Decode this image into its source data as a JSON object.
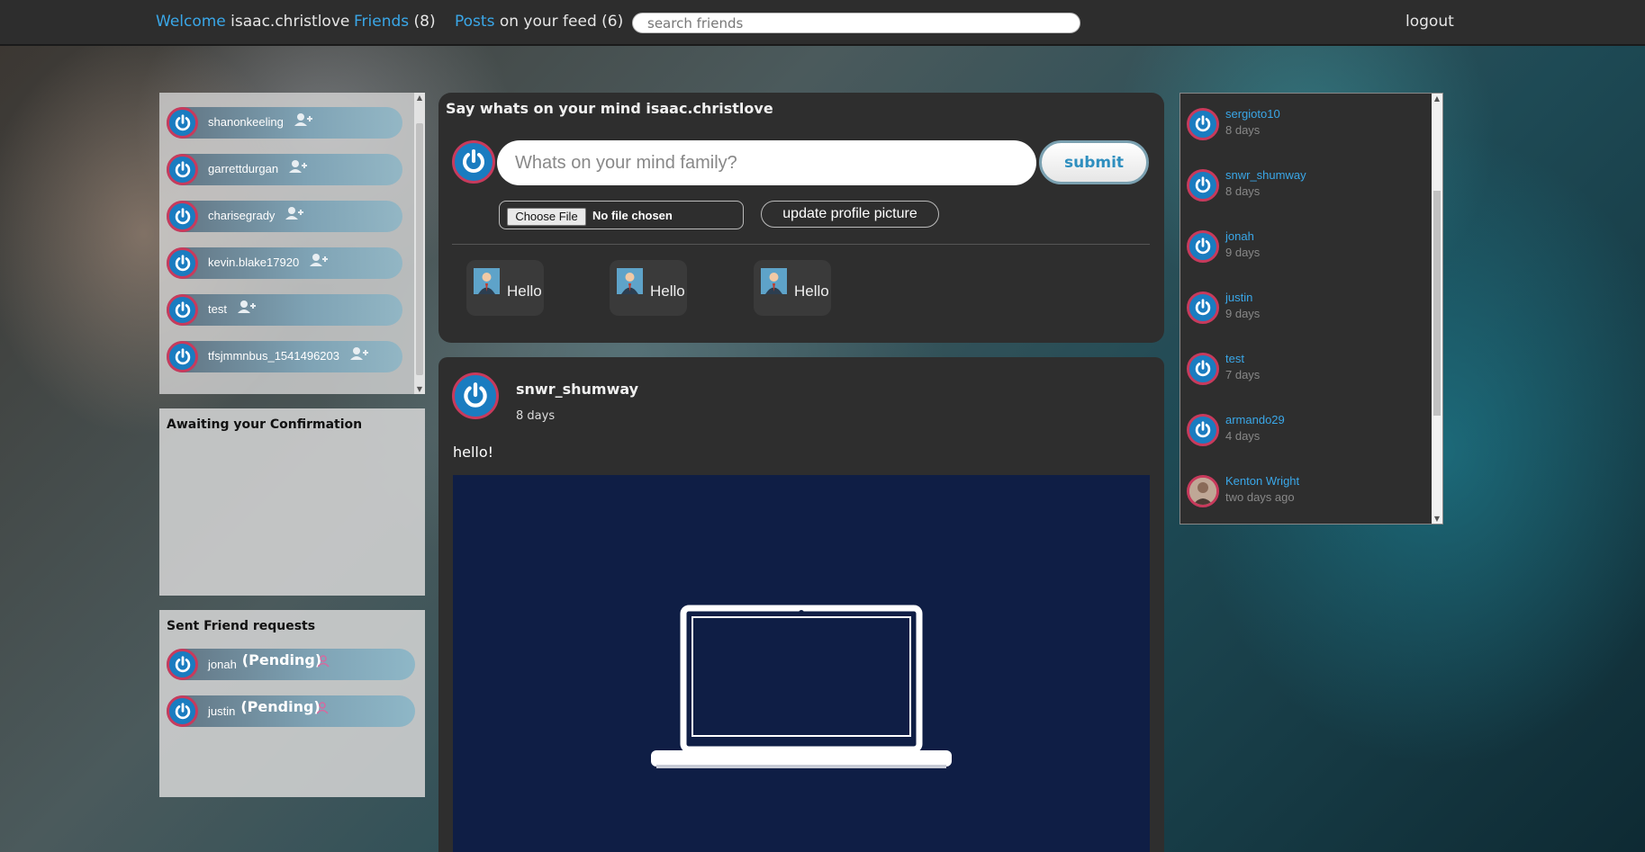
{
  "nav": {
    "welcome_label": "Welcome",
    "username": "isaac.christlove",
    "friends_label": "Friends",
    "friends_count": "(8)",
    "posts_label": "Posts",
    "posts_suffix": "on your feed (6)",
    "search_placeholder": "search friends",
    "logout_label": "logout"
  },
  "friends_list": [
    {
      "name": "shanonkeeling"
    },
    {
      "name": "garrettdurgan"
    },
    {
      "name": "charisegrady"
    },
    {
      "name": "kevin.blake17920"
    },
    {
      "name": "test"
    },
    {
      "name": "tfsjmmnbus_1541496203"
    }
  ],
  "awaiting": {
    "title": "Awaiting your Confirmation"
  },
  "sent_requests": {
    "title": "Sent Friend requests",
    "items": [
      {
        "name": "jonah",
        "status": "(Pending)"
      },
      {
        "name": "justin",
        "status": "(Pending)"
      }
    ]
  },
  "composer": {
    "title": "Say whats on your mind isaac.christlove",
    "placeholder": "Whats on your mind family?",
    "submit_label": "submit",
    "file_button": "Choose File",
    "file_status": "No file chosen",
    "update_label": "update profile picture",
    "hello_cards": [
      {
        "label": "Hello"
      },
      {
        "label": "Hello"
      },
      {
        "label": "Hello"
      }
    ]
  },
  "post": {
    "author": "snwr_shumway",
    "time": "8 days",
    "text": "hello!"
  },
  "activity": [
    {
      "name": "sergioto10",
      "time": "8 days"
    },
    {
      "name": "snwr_shumway",
      "time": "8 days"
    },
    {
      "name": "jonah",
      "time": "9 days"
    },
    {
      "name": "justin",
      "time": "9 days"
    },
    {
      "name": "test",
      "time": "7 days"
    },
    {
      "name": "armando29",
      "time": "4 days"
    },
    {
      "name": "Kenton Wright",
      "time": "two days ago"
    }
  ],
  "colors": {
    "accent": "#3aa7e8",
    "avatar_blue": "#1a7cc0",
    "avatar_ring": "#c83a5c",
    "panel_dark": "#2e2e2e"
  }
}
